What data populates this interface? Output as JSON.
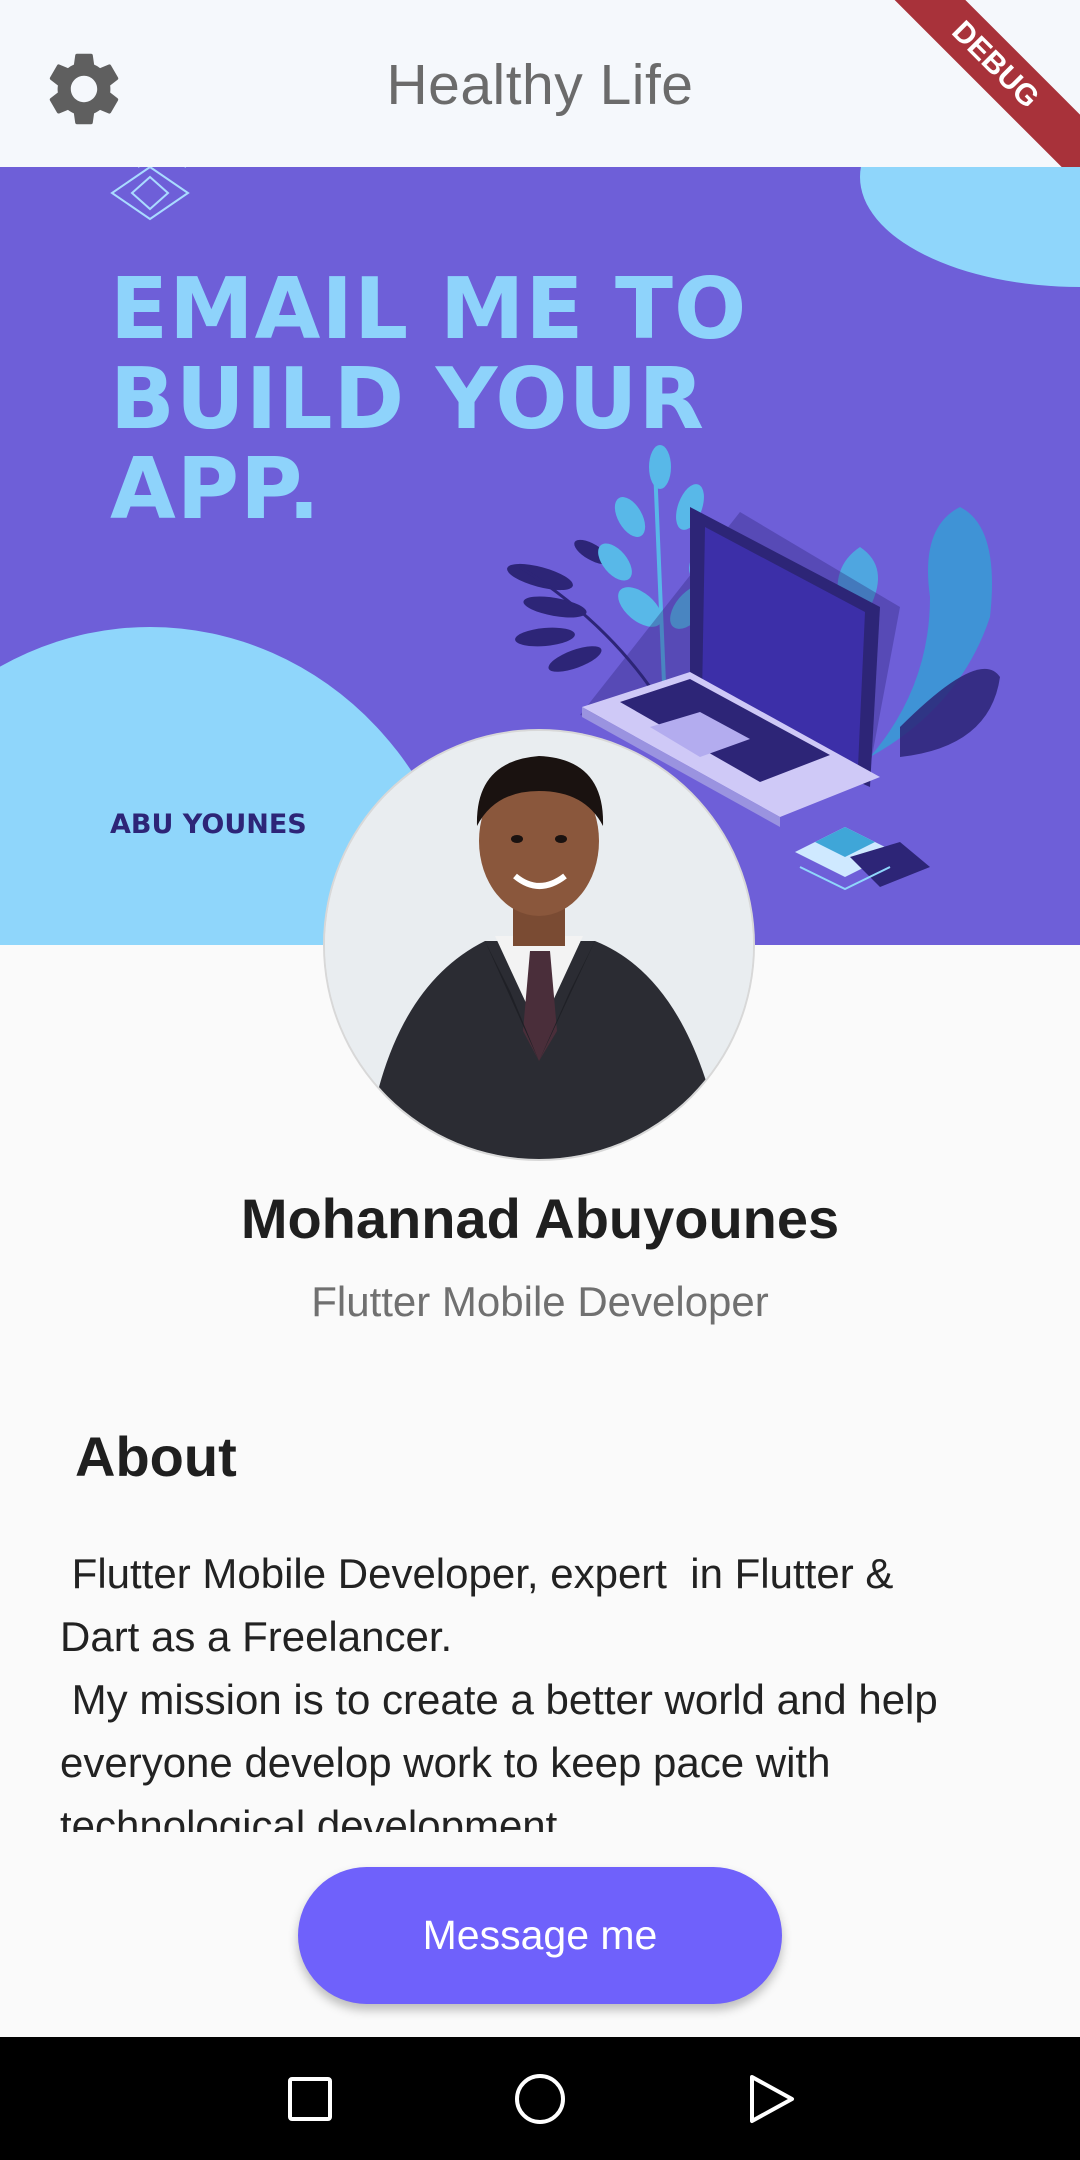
{
  "appbar": {
    "title": "Healthy Life",
    "settings_icon": "gear-icon",
    "debug_label": "DEBUG"
  },
  "banner": {
    "headline": "EMAIL ME TO\nBUILD YOUR\nAPP.",
    "name": "ABU YOUNES",
    "colors": {
      "background": "#6e5fd8",
      "accent": "#8ed3fb"
    }
  },
  "profile": {
    "name": "Mohannad Abuyounes",
    "role": "Flutter Mobile Developer"
  },
  "about": {
    "heading": "About",
    "text": " Flutter Mobile Developer, expert  in Flutter &\nDart as a Freelancer.\n My mission is to create a better world and help\neveryone develop work to keep pace with\ntechnological development"
  },
  "actions": {
    "message_label": "Message me",
    "button_color": "#6f61fb"
  },
  "navbar": {
    "recents_icon": "square-icon",
    "home_icon": "circle-icon",
    "back_icon": "triangle-back-icon"
  }
}
